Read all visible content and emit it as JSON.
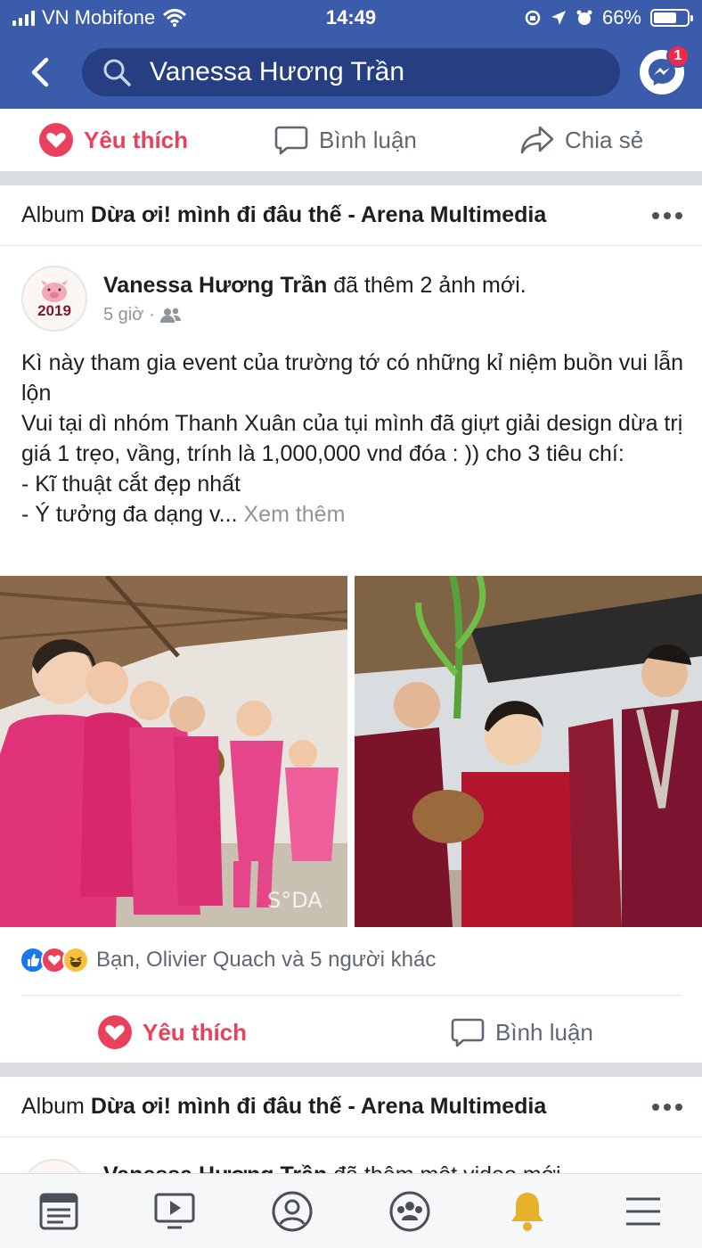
{
  "status_bar": {
    "carrier": "VN Mobifone",
    "time": "14:49",
    "battery": "66%",
    "battery_level": 0.66
  },
  "header": {
    "search_value": "Vanessa Hương Trần",
    "messenger_badge": "1"
  },
  "top_actions": {
    "like": "Yêu thích",
    "comment": "Bình luận",
    "share": "Chia sẻ"
  },
  "album1": {
    "prefix": "Album",
    "name": "Dừa ơi! mình đi đâu thế - Arena Multimedia"
  },
  "post": {
    "author": "Vanessa Hương Trần",
    "action": "đã thêm 2 ảnh mới.",
    "time": "5 giờ",
    "avatar_text": "2019",
    "text_lines": [
      "Kì này tham gia event của trường tớ có những kỉ niệm buồn vui lẫn lộn",
      "Vui tại dì nhóm Thanh Xuân của tụi mình đã giựt giải design dừa trị giá 1 trẹo, vầng, trính là 1,000,000 vnd đóa : )) cho 3 tiêu chí:",
      "- Kĩ thuật cắt đẹp nhất"
    ],
    "last_line": "- Ý tưởng đa dạng v...",
    "see_more": "Xem thêm",
    "photo1_watermark": "S°DA",
    "reactions_text": "Bạn, Olivier Quach và 5 người khác",
    "like": "Yêu thích",
    "comment": "Bình luận"
  },
  "album2": {
    "prefix": "Album",
    "name": "Dừa ơi! mình đi đâu thế - Arena Multimedia"
  },
  "next_post": {
    "author": "Vanessa Hương Trần",
    "action": "đã thêm một video mới."
  },
  "colors": {
    "header": "#3b5bab",
    "search": "#263f83",
    "like_red": "#e9405b",
    "notification_gold": "#e8b12c"
  },
  "nav_icons": [
    "news-feed-icon",
    "watch-icon",
    "profile-icon",
    "groups-icon",
    "notifications-icon",
    "menu-icon"
  ]
}
